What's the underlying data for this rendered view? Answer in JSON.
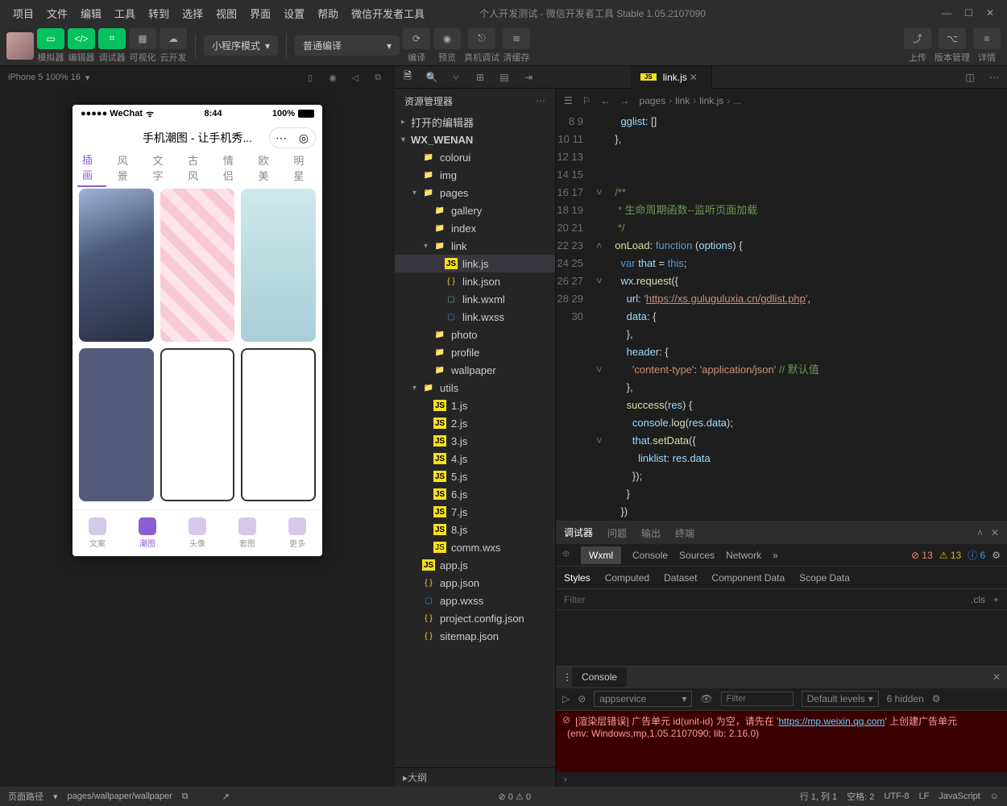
{
  "menubar": [
    "项目",
    "文件",
    "编辑",
    "工具",
    "转到",
    "选择",
    "视图",
    "界面",
    "设置",
    "帮助",
    "微信开发者工具"
  ],
  "title": "个人开发测试 - 微信开发者工具 Stable 1.05.2107090",
  "toolbar": {
    "sim": "模拟器",
    "editor": "编辑器",
    "debugger": "调试器",
    "visual": "可视化",
    "cloud": "云开发",
    "mode": "小程序模式",
    "compile_mode": "普通编译",
    "compile": "编译",
    "preview": "预览",
    "remote": "真机调试",
    "cache": "清缓存",
    "upload": "上传",
    "version": "版本管理",
    "details": "详情"
  },
  "sim_info": "iPhone 5 100% 16",
  "phone": {
    "carrier": "●●●●● WeChat",
    "wifi": "⌃",
    "time": "8:44",
    "batt": "100%",
    "title": "手机潮图 - 让手机秀...",
    "tabs": [
      "插画",
      "风景",
      "文字",
      "古风",
      "情侣",
      "欧美",
      "明星"
    ],
    "bottom": [
      "文案",
      "潮图",
      "头像",
      "套图",
      "更多"
    ]
  },
  "explorer": {
    "title": "资源管理器",
    "opened": "打开的编辑器",
    "root": "WX_WENAN",
    "tree": [
      {
        "l": 1,
        "t": "folder",
        "n": "colorui"
      },
      {
        "l": 1,
        "t": "folder-g",
        "n": "img"
      },
      {
        "l": 1,
        "t": "folder-g",
        "n": "pages",
        "open": true,
        "children": [
          {
            "l": 2,
            "t": "folder",
            "n": "gallery"
          },
          {
            "l": 2,
            "t": "folder",
            "n": "index"
          },
          {
            "l": 2,
            "t": "folder",
            "n": "link",
            "open": true,
            "children": [
              {
                "l": 3,
                "t": "js",
                "n": "link.js",
                "sel": true
              },
              {
                "l": 3,
                "t": "json",
                "n": "link.json"
              },
              {
                "l": 3,
                "t": "wxml",
                "n": "link.wxml"
              },
              {
                "l": 3,
                "t": "wxss",
                "n": "link.wxss"
              }
            ]
          },
          {
            "l": 2,
            "t": "folder",
            "n": "photo"
          },
          {
            "l": 2,
            "t": "folder",
            "n": "profile"
          },
          {
            "l": 2,
            "t": "folder",
            "n": "wallpaper"
          }
        ]
      },
      {
        "l": 1,
        "t": "folder-g",
        "n": "utils",
        "open": true,
        "children": [
          {
            "l": 2,
            "t": "js",
            "n": "1.js"
          },
          {
            "l": 2,
            "t": "js",
            "n": "2.js"
          },
          {
            "l": 2,
            "t": "js",
            "n": "3.js"
          },
          {
            "l": 2,
            "t": "js",
            "n": "4.js"
          },
          {
            "l": 2,
            "t": "js",
            "n": "5.js"
          },
          {
            "l": 2,
            "t": "js",
            "n": "6.js"
          },
          {
            "l": 2,
            "t": "js",
            "n": "7.js"
          },
          {
            "l": 2,
            "t": "js",
            "n": "8.js"
          },
          {
            "l": 2,
            "t": "wxs",
            "n": "comm.wxs"
          }
        ]
      },
      {
        "l": 1,
        "t": "js",
        "n": "app.js"
      },
      {
        "l": 1,
        "t": "json",
        "n": "app.json"
      },
      {
        "l": 1,
        "t": "wxss",
        "n": "app.wxss"
      },
      {
        "l": 1,
        "t": "json",
        "n": "project.config.json"
      },
      {
        "l": 1,
        "t": "json",
        "n": "sitemap.json"
      }
    ],
    "outline": "大纲"
  },
  "editor": {
    "tab": "link.js",
    "breadcrumb": [
      "pages",
      "link",
      "link.js",
      "..."
    ],
    "lines_start": 8,
    "folds": {
      "12": "˅",
      "15": "˄",
      "17": "˅",
      "22": "˅",
      "26": "˅"
    },
    "code": [
      "    <span class='prop'>gglist</span>: []",
      "  },",
      "",
      "",
      "  <span class='cmt'>/**</span>",
      "<span class='cmt'>   * 生命周期函数--监听页面加载</span>",
      "<span class='cmt'>   */</span>",
      "  <span class='fn'>onLoad</span>: <span class='kw'>function</span> (<span class='prop'>options</span>) {",
      "    <span class='kw'>var</span> <span class='prop'>that</span> = <span class='this'>this</span>;",
      "    <span class='prop'>wx</span>.<span class='fn'>request</span>({",
      "      <span class='prop'>url</span>: <span class='str'>'<span class='url'>https://xs.guluguluxia.cn/gdlist.php</span>'</span>,",
      "      <span class='prop'>data</span>: {",
      "      },",
      "      <span class='prop'>header</span>: {",
      "        <span class='str'>'content-type'</span>: <span class='str'>'application/json'</span> <span class='cmt'>// 默认值</span>",
      "      },",
      "      <span class='fn'>success</span>(<span class='prop'>res</span>) {",
      "        <span class='prop'>console</span>.<span class='fn'>log</span>(<span class='prop'>res</span>.<span class='prop'>data</span>);",
      "        <span class='prop'>that</span>.<span class='fn'>setData</span>({",
      "          <span class='prop'>linklist</span>: <span class='prop'>res</span>.<span class='prop'>data</span>",
      "        });",
      "      }",
      "    })"
    ]
  },
  "debugger": {
    "tabs": [
      "调试器",
      "问题",
      "输出",
      "终端"
    ],
    "sub": [
      "Wxml",
      "Console",
      "Sources",
      "Network"
    ],
    "counts": {
      "err": "13",
      "warn": "13",
      "info": "6"
    },
    "styles_tabs": [
      "Styles",
      "Computed",
      "Dataset",
      "Component Data",
      "Scope Data"
    ],
    "filter": "Filter",
    "cls": ".cls",
    "console_title": "Console",
    "scope": "appservice",
    "filter2": "Filter",
    "levels": "Default levels",
    "hidden": "6 hidden",
    "log1": "[渲染层错误] 广告单元 id(unit-id) 为空，请先在 '",
    "log1_link": "https://mp.weixin.qq.com",
    "log1_end": "' 上创建广告单元",
    "log2": "(env: Windows,mp,1.05.2107090; lib: 2.16.0)"
  },
  "statusbar": {
    "path_lbl": "页面路径",
    "path": "pages/wallpaper/wallpaper",
    "issues": "⊘ 0 ⚠ 0",
    "line": "行 1, 列 1",
    "spaces": "空格: 2",
    "enc": "UTF-8",
    "eol": "LF",
    "lang": "JavaScript"
  }
}
